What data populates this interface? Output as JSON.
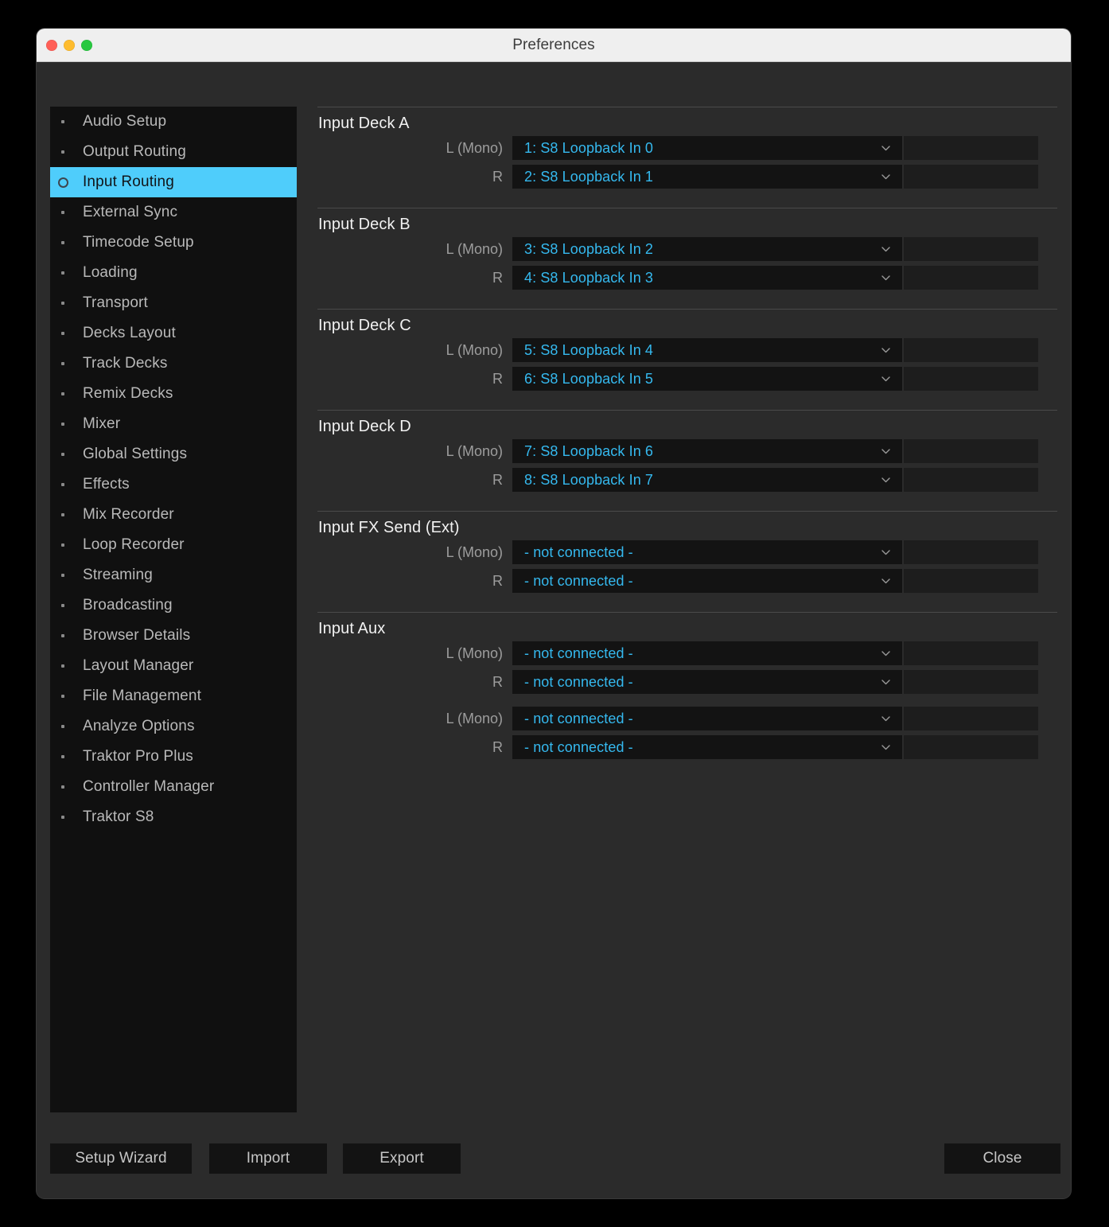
{
  "window": {
    "title": "Preferences",
    "traffic_lights": [
      "close-button",
      "minimize-button",
      "maximize-button"
    ],
    "accent_color": "#4fcdfb",
    "value_color": "#35b9ef"
  },
  "sidebar": {
    "items": [
      {
        "label": "Audio Setup",
        "selected": false
      },
      {
        "label": "Output Routing",
        "selected": false
      },
      {
        "label": "Input Routing",
        "selected": true
      },
      {
        "label": "External Sync",
        "selected": false
      },
      {
        "label": "Timecode Setup",
        "selected": false
      },
      {
        "label": "Loading",
        "selected": false
      },
      {
        "label": "Transport",
        "selected": false
      },
      {
        "label": "Decks Layout",
        "selected": false
      },
      {
        "label": "Track Decks",
        "selected": false
      },
      {
        "label": "Remix Decks",
        "selected": false
      },
      {
        "label": "Mixer",
        "selected": false
      },
      {
        "label": "Global Settings",
        "selected": false
      },
      {
        "label": "Effects",
        "selected": false
      },
      {
        "label": "Mix Recorder",
        "selected": false
      },
      {
        "label": "Loop Recorder",
        "selected": false
      },
      {
        "label": "Streaming",
        "selected": false
      },
      {
        "label": "Broadcasting",
        "selected": false
      },
      {
        "label": "Browser Details",
        "selected": false
      },
      {
        "label": "Layout Manager",
        "selected": false
      },
      {
        "label": "File Management",
        "selected": false
      },
      {
        "label": "Analyze Options",
        "selected": false
      },
      {
        "label": "Traktor Pro Plus",
        "selected": false
      },
      {
        "label": "Controller Manager",
        "selected": false
      },
      {
        "label": "Traktor S8",
        "selected": false
      }
    ]
  },
  "main": {
    "sections": [
      {
        "title": "Input Deck A",
        "rows": [
          {
            "label": "L (Mono)",
            "value": "1: S8 Loopback In 0",
            "gap_before": false
          },
          {
            "label": "R",
            "value": "2: S8 Loopback In 1",
            "gap_before": false
          }
        ]
      },
      {
        "title": "Input Deck B",
        "rows": [
          {
            "label": "L (Mono)",
            "value": "3: S8 Loopback In 2",
            "gap_before": false
          },
          {
            "label": "R",
            "value": "4: S8 Loopback In 3",
            "gap_before": false
          }
        ]
      },
      {
        "title": "Input Deck C",
        "rows": [
          {
            "label": "L (Mono)",
            "value": "5: S8 Loopback In 4",
            "gap_before": false
          },
          {
            "label": "R",
            "value": "6: S8 Loopback In 5",
            "gap_before": false
          }
        ]
      },
      {
        "title": "Input Deck D",
        "rows": [
          {
            "label": "L (Mono)",
            "value": "7: S8 Loopback In 6",
            "gap_before": false
          },
          {
            "label": "R",
            "value": "8: S8 Loopback In 7",
            "gap_before": false
          }
        ]
      },
      {
        "title": "Input FX Send (Ext)",
        "rows": [
          {
            "label": "L (Mono)",
            "value": "- not connected -",
            "gap_before": false
          },
          {
            "label": "R",
            "value": "- not connected -",
            "gap_before": false
          }
        ]
      },
      {
        "title": "Input Aux",
        "rows": [
          {
            "label": "L (Mono)",
            "value": "- not connected -",
            "gap_before": false
          },
          {
            "label": "R",
            "value": "- not connected -",
            "gap_before": false
          },
          {
            "label": "L (Mono)",
            "value": "- not connected -",
            "gap_before": true
          },
          {
            "label": "R",
            "value": "- not connected -",
            "gap_before": false
          }
        ]
      }
    ]
  },
  "footer": {
    "setup_wizard_label": "Setup Wizard",
    "import_label": "Import",
    "export_label": "Export",
    "close_label": "Close"
  }
}
